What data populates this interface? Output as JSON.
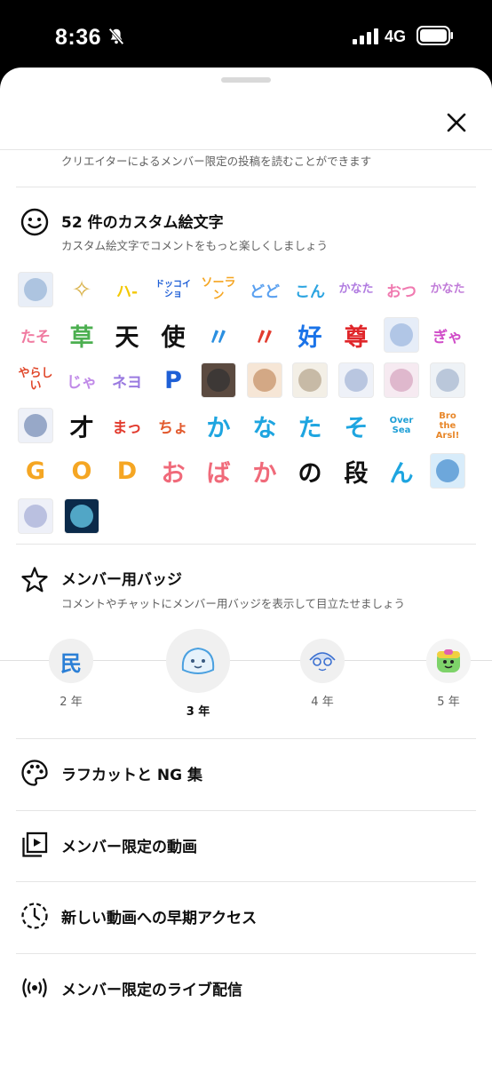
{
  "status_bar": {
    "time": "8:36",
    "network": "4G"
  },
  "benefits": {
    "partial_text": "クリエイターによるメンバー限定の投稿を読むことができます",
    "emoji": {
      "title": "52 件のカスタム絵文字",
      "subtitle": "カスタム絵文字でコメントをもっと楽しくしましょう",
      "items": [
        {
          "t": "",
          "c": "#9ab6d8",
          "bg": "#e8eef7"
        },
        {
          "t": "✧",
          "c": "#d9b24a",
          "bg": "#ffffff"
        },
        {
          "t": "ハ-",
          "c": "#f3c800",
          "bg": "#ffffff"
        },
        {
          "t": "ドッコイショ",
          "c": "#1f5fd6",
          "bg": "#ffffff"
        },
        {
          "t": "ソーラン",
          "c": "#f5a623",
          "bg": "#ffffff"
        },
        {
          "t": "どど",
          "c": "#5aa0f0",
          "bg": "#ffffff"
        },
        {
          "t": "こん",
          "c": "#29a3e0",
          "bg": "#ffffff"
        },
        {
          "t": "かなた",
          "c": "#b07ae0",
          "bg": "#ffffff"
        },
        {
          "t": "おつ",
          "c": "#f07ab0",
          "bg": "#ffffff"
        },
        {
          "t": "かなた",
          "c": "#c07ad8",
          "bg": "#ffffff"
        },
        {
          "t": "たそ",
          "c": "#f07aa0",
          "bg": "#ffffff"
        },
        {
          "t": "草",
          "c": "#4caf50",
          "bg": "#ffffff"
        },
        {
          "t": "天",
          "c": "#111111",
          "bg": "#ffffff"
        },
        {
          "t": "使",
          "c": "#111111",
          "bg": "#ffffff"
        },
        {
          "t": "〃",
          "c": "#2b8fe0",
          "bg": "#ffffff"
        },
        {
          "t": "〃",
          "c": "#e23b2e",
          "bg": "#ffffff"
        },
        {
          "t": "好",
          "c": "#1a73e8",
          "bg": "#ffffff"
        },
        {
          "t": "尊",
          "c": "#e0262a",
          "bg": "#ffffff"
        },
        {
          "t": "",
          "c": "#9fb8e0",
          "bg": "#e6edf8"
        },
        {
          "t": "ぎゃ",
          "c": "#d04cc8",
          "bg": "#ffffff"
        },
        {
          "t": "やらしい",
          "c": "#e0472a",
          "bg": "#ffffff"
        },
        {
          "t": "じゃ",
          "c": "#c08ae8",
          "bg": "#ffffff"
        },
        {
          "t": "ネヨ",
          "c": "#9a7ae0",
          "bg": "#ffffff"
        },
        {
          "t": "P",
          "c": "#1e5fd6",
          "bg": "#ffffff"
        },
        {
          "t": "",
          "c": "#333333",
          "bg": "#5b4a40"
        },
        {
          "t": "",
          "c": "#c7936a",
          "bg": "#f6e6d6"
        },
        {
          "t": "",
          "c": "#b8a890",
          "bg": "#f3efe6"
        },
        {
          "t": "",
          "c": "#a7b7d8",
          "bg": "#eef1f8"
        },
        {
          "t": "",
          "c": "#d7a7c0",
          "bg": "#f6eaf1"
        },
        {
          "t": "",
          "c": "#a8b8d0",
          "bg": "#eef2f6"
        },
        {
          "t": "",
          "c": "#7a8fb8",
          "bg": "#eef1f8"
        },
        {
          "t": "才",
          "c": "#111111",
          "bg": "#ffffff"
        },
        {
          "t": "まっ",
          "c": "#e23b2e",
          "bg": "#ffffff"
        },
        {
          "t": "ちょ",
          "c": "#e25a2e",
          "bg": "#ffffff"
        },
        {
          "t": "か",
          "c": "#1ea5e0",
          "bg": "#ffffff"
        },
        {
          "t": "な",
          "c": "#1ea5e0",
          "bg": "#ffffff"
        },
        {
          "t": "た",
          "c": "#1ea5e0",
          "bg": "#ffffff"
        },
        {
          "t": "そ",
          "c": "#1ea5e0",
          "bg": "#ffffff"
        },
        {
          "t": "Over Sea",
          "c": "#1e9fd6",
          "bg": "#ffffff"
        },
        {
          "t": "Bro the Arsl!",
          "c": "#e8872a",
          "bg": "#ffffff"
        },
        {
          "t": "G",
          "c": "#f5a623",
          "bg": "#ffffff"
        },
        {
          "t": "O",
          "c": "#f5a623",
          "bg": "#ffffff"
        },
        {
          "t": "D",
          "c": "#f5a623",
          "bg": "#ffffff"
        },
        {
          "t": "お",
          "c": "#f06a7a",
          "bg": "#ffffff"
        },
        {
          "t": "ば",
          "c": "#f06a7a",
          "bg": "#ffffff"
        },
        {
          "t": "か",
          "c": "#f06a7a",
          "bg": "#ffffff"
        },
        {
          "t": "の",
          "c": "#111111",
          "bg": "#ffffff"
        },
        {
          "t": "段",
          "c": "#111111",
          "bg": "#ffffff"
        },
        {
          "t": "ん",
          "c": "#1ea5e0",
          "bg": "#ffffff"
        },
        {
          "t": "",
          "c": "#4a90d0",
          "bg": "#d8ecfa"
        },
        {
          "t": "",
          "c": "#a8b0d8",
          "bg": "#eef0f8"
        },
        {
          "t": "",
          "c": "#6ad0f0",
          "bg": "#0b2a4a"
        }
      ]
    },
    "badge": {
      "title": "メンバー用バッジ",
      "subtitle": "コメントやチャットにメンバー用バッジを表示して目立たせましょう",
      "items": [
        {
          "label": "2 年",
          "glyph": "民",
          "glyph_color": "#2b7fd6",
          "selected": false
        },
        {
          "label": "3 年",
          "glyph": "",
          "glyph_color": "#4aa0e0",
          "selected": true
        },
        {
          "label": "4 年",
          "glyph": "",
          "glyph_color": "#3a6fd0",
          "selected": false
        },
        {
          "label": "5 年",
          "glyph": "",
          "glyph_color": "#60b860",
          "selected": false
        }
      ]
    },
    "rows": [
      {
        "label": "ラフカットと NG 集",
        "icon": "palette-icon"
      },
      {
        "label": "メンバー限定の動画",
        "icon": "video-library-icon"
      },
      {
        "label": "新しい動画への早期アクセス",
        "icon": "early-access-clock-icon"
      },
      {
        "label": "メンバー限定のライブ配信",
        "icon": "live-broadcast-icon"
      }
    ]
  }
}
